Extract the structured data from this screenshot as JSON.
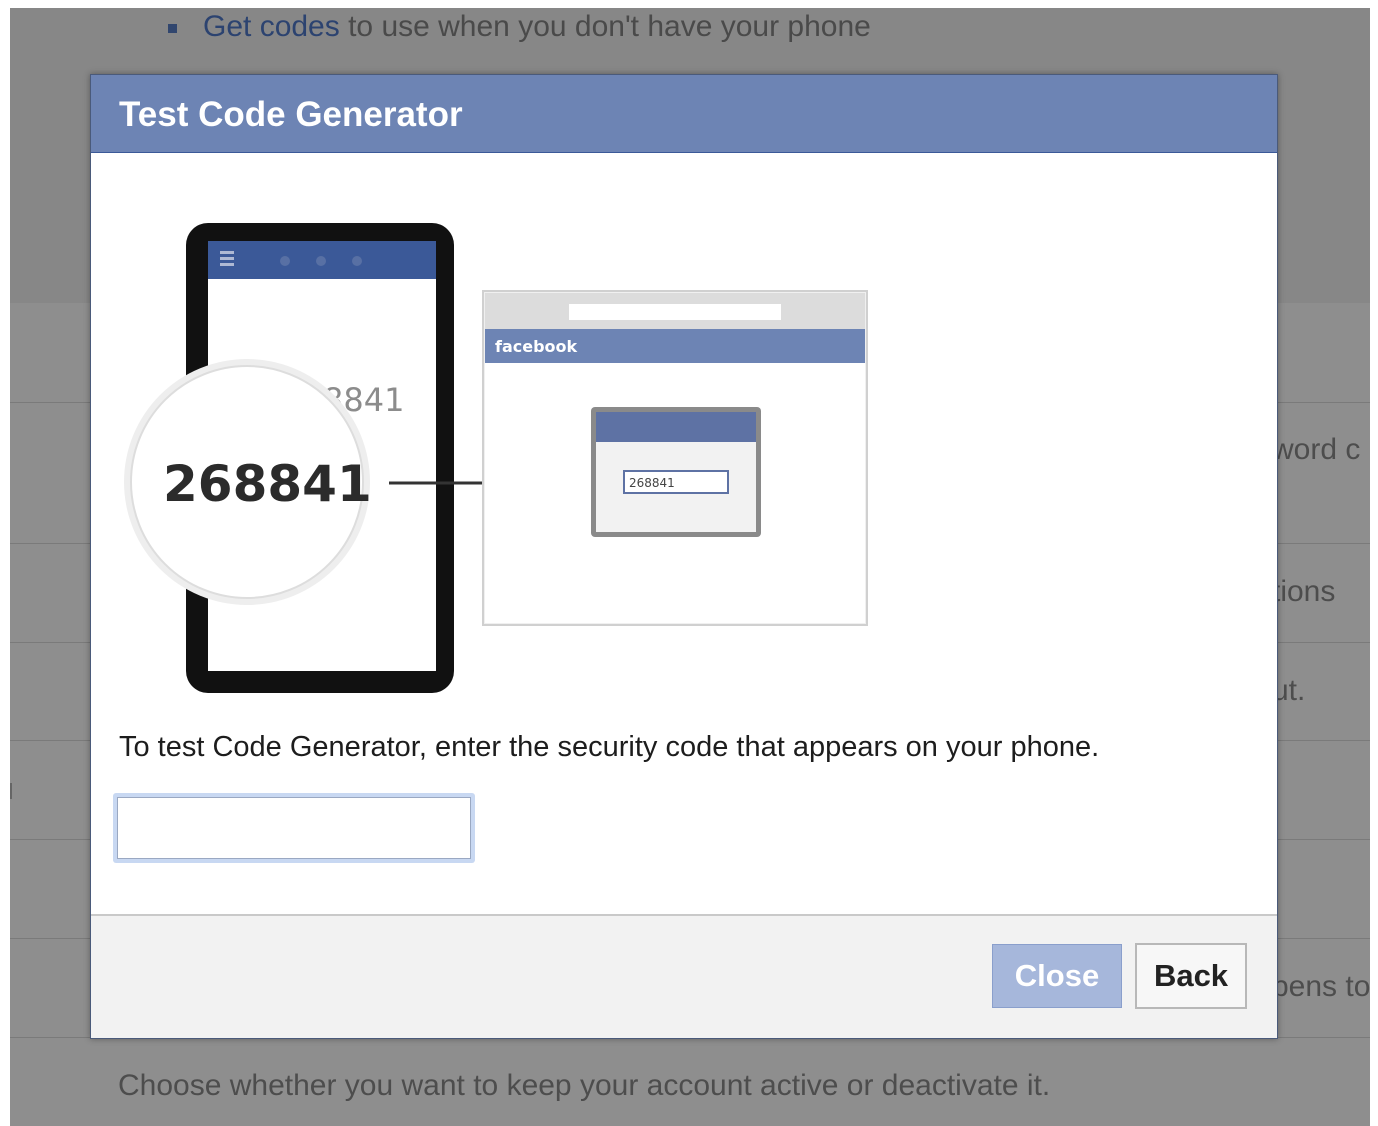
{
  "background": {
    "first_line_link": "Get codes",
    "first_line_rest": " to use when you don't have your phone",
    "right_fragments": [
      "word c",
      "tions",
      "ut.",
      "pens to"
    ],
    "bottom_text": "Choose whether you want to keep your account active or deactivate it."
  },
  "dialog": {
    "title": "Test Code Generator",
    "illustration": {
      "phone_code_partial": "8841",
      "magnified_code": "268841",
      "browser_brand": "facebook",
      "entered_code": "268841"
    },
    "instruction": "To test Code Generator, enter the security code that appears on your phone.",
    "code_input": {
      "value": "",
      "placeholder": ""
    },
    "close_label": "Close",
    "back_label": "Back"
  },
  "colors": {
    "header_blue": "#6d84b4",
    "close_button_bg": "#a6b7db",
    "overlay_gray": "#8e8e8e"
  }
}
